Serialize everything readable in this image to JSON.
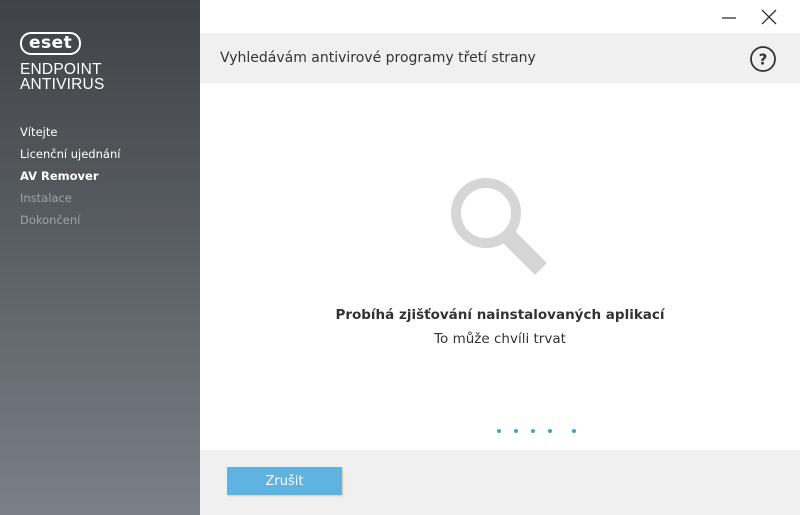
{
  "sidebar": {
    "logo_text": "eset",
    "product_line1": "ENDPOINT",
    "product_line2": "ANTIVIRUS",
    "items": [
      {
        "label": "Vítejte",
        "state": "done"
      },
      {
        "label": "Licenční ujednání",
        "state": "done"
      },
      {
        "label": "AV Remover",
        "state": "active"
      },
      {
        "label": "Instalace",
        "state": "disabled"
      },
      {
        "label": "Dokončení",
        "state": "disabled"
      }
    ]
  },
  "window": {
    "minimize_icon": "minimize-icon",
    "close_icon": "close-icon"
  },
  "header": {
    "title": "Vyhledávám antivirové programy třetí strany",
    "help_icon": "help-icon"
  },
  "main": {
    "graphic_icon": "magnifier-icon",
    "status_title": "Probíhá zjišťování nainstalovaných aplikací",
    "status_subtitle": "To může chvíli trvat",
    "progress_dots": 5
  },
  "footer": {
    "cancel_label": "Zrušit"
  },
  "colors": {
    "accent": "#5fb3e0",
    "dots": "#3aa5d8",
    "sidebar_top": "#3f4347",
    "sidebar_bottom": "#7a8086"
  }
}
